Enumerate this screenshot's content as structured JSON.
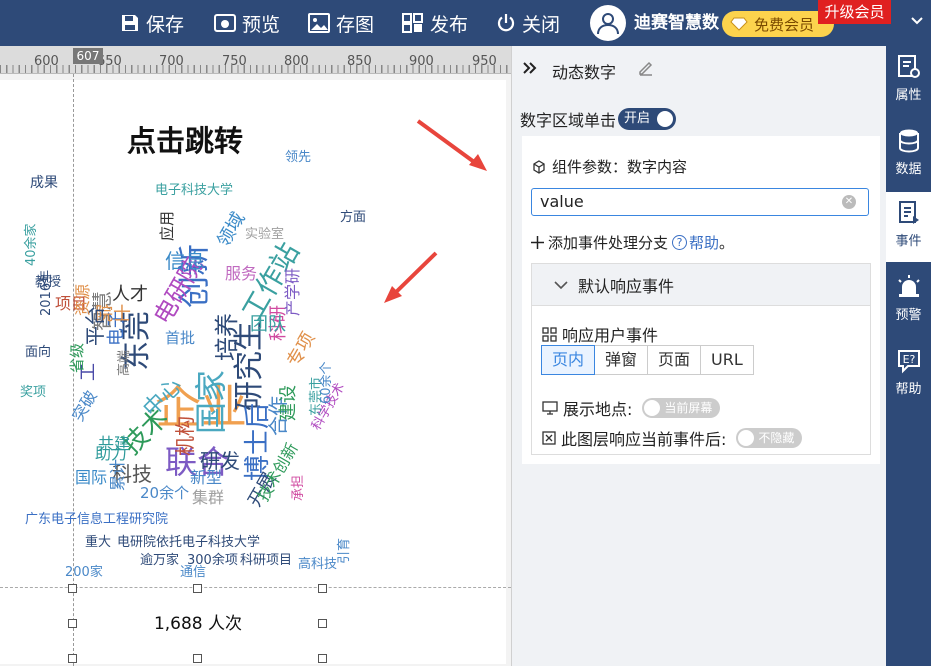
{
  "toolbar": {
    "save": "保存",
    "preview": "预览",
    "save_image": "存图",
    "publish": "发布",
    "close": "关闭",
    "username": "迪赛智慧数",
    "member_badge": "免费会员",
    "upgrade": "升级会员"
  },
  "ruler": {
    "labels": [
      "600",
      "650",
      "700",
      "750",
      "800",
      "850",
      "900",
      "950"
    ],
    "marker": "607"
  },
  "canvas": {
    "title": "点击跳转",
    "counter": "1,688 人次",
    "word_cloud": [
      {
        "t": "企业",
        "c": "#f0a050"
      },
      {
        "t": "创新",
        "c": "#3a6fc4"
      },
      {
        "t": "联合",
        "c": "#7d5bc4"
      },
      {
        "t": "东莞",
        "c": "#2e4a78"
      },
      {
        "t": "国家",
        "c": "#4aa8c0"
      },
      {
        "t": "研究生",
        "c": "#2e4a78"
      },
      {
        "t": "工作站",
        "c": "#3aa0a0"
      },
      {
        "t": "博士后",
        "c": "#3a6fc4"
      },
      {
        "t": "技术",
        "c": "#2e9a5a"
      },
      {
        "t": "合作",
        "c": "#4a88c8"
      },
      {
        "t": "科技",
        "c": "#555555"
      },
      {
        "t": "培养",
        "c": "#2e4a78"
      },
      {
        "t": "电研院",
        "c": "#b04ac0"
      },
      {
        "t": "智慧",
        "c": "#7a7a7a"
      },
      {
        "t": "研发",
        "c": "#2e4a78"
      },
      {
        "t": "信息",
        "c": "#3a8ac8"
      },
      {
        "t": "机构",
        "c": "#c0503a"
      },
      {
        "t": "人才",
        "c": "#333333"
      },
      {
        "t": "工",
        "c": "#4a4aa8"
      },
      {
        "t": "科研",
        "c": "#d04aa0"
      },
      {
        "t": "中心",
        "c": "#4aa8c0"
      },
      {
        "t": "电子",
        "c": "#3a6fc4"
      },
      {
        "t": "院士",
        "c": "#e0904a"
      },
      {
        "t": "服务",
        "c": "#c06ac0"
      },
      {
        "t": "高端",
        "c": "#7a7a7a"
      },
      {
        "t": "新型",
        "c": "#4a88c8"
      },
      {
        "t": "集群",
        "c": "#a0a0a0"
      },
      {
        "t": "国际",
        "c": "#3a8ac8"
      },
      {
        "t": "助力",
        "c": "#2e9a9a"
      },
      {
        "t": "开展",
        "c": "#2e4a78"
      },
      {
        "t": "建设",
        "c": "#2e9a5a"
      },
      {
        "t": "领域",
        "c": "#3a8ac8"
      },
      {
        "t": "产学研",
        "c": "#7d5bc4"
      },
      {
        "t": "团队",
        "c": "#3aa0a0"
      },
      {
        "t": "项目",
        "c": "#c0503a"
      },
      {
        "t": "平台",
        "c": "#2e4a78"
      },
      {
        "t": "专项",
        "c": "#e0904a"
      },
      {
        "t": "省级",
        "c": "#2e9a5a"
      },
      {
        "t": "首批",
        "c": "#4a88c8"
      },
      {
        "t": "应用",
        "c": "#333333"
      },
      {
        "t": "20余个",
        "c": "#4a88c8"
      },
      {
        "t": "技术创新",
        "c": "#2e9a5a"
      },
      {
        "t": "科学技术",
        "c": "#b04ac0"
      },
      {
        "t": "成果",
        "c": "#2e4a78"
      },
      {
        "t": "方面",
        "c": "#2e4a78"
      },
      {
        "t": "电子科技大学",
        "c": "#3aa0a0"
      },
      {
        "t": "广东电子信息工程研究院",
        "c": "#3a6fc4"
      },
      {
        "t": "电研院依托电子科技大学",
        "c": "#2e4a78"
      },
      {
        "t": "高科技",
        "c": "#4a88c8"
      },
      {
        "t": "引育",
        "c": "#4a88c8"
      },
      {
        "t": "300余项",
        "c": "#2e4a78"
      },
      {
        "t": "科研项目",
        "c": "#2e4a78"
      },
      {
        "t": "逾万家",
        "c": "#2e4a78"
      },
      {
        "t": "通信",
        "c": "#4a88c8"
      },
      {
        "t": "200家",
        "c": "#4a88c8"
      },
      {
        "t": "2016年",
        "c": "#2e4a78"
      },
      {
        "t": "教授",
        "c": "#2e4a78"
      },
      {
        "t": "40余家",
        "c": "#3aa0a0"
      },
      {
        "t": "实验室",
        "c": "#a0a0a0"
      },
      {
        "t": "领先",
        "c": "#4a88c8"
      },
      {
        "t": "东莞市",
        "c": "#3aa0a0"
      },
      {
        "t": "60余个",
        "c": "#4a88c8"
      },
      {
        "t": "重大",
        "c": "#2e4a78"
      },
      {
        "t": "共建",
        "c": "#2e9a9a"
      },
      {
        "t": "累计",
        "c": "#4a88c8"
      },
      {
        "t": "面向",
        "c": "#2e4a78"
      },
      {
        "t": "奖项",
        "c": "#3aa0a0"
      },
      {
        "t": "资源",
        "c": "#e0904a"
      },
      {
        "t": "突破",
        "c": "#4a88c8"
      },
      {
        "t": "承担",
        "c": "#d04aa0"
      }
    ]
  },
  "panel": {
    "title": "动态数字",
    "click_label": "数字区域单击",
    "click_toggle": "开启",
    "param_label": "组件参数：数字内容",
    "param_value": "value",
    "add_branch": "添加事件处理分支",
    "help": "帮助",
    "help_suffix": "。",
    "section_title": "默认响应事件",
    "response_label": "响应用户事件",
    "segments": [
      "页内",
      "弹窗",
      "页面",
      "URL"
    ],
    "show_location_label": "展示地点:",
    "show_location_value": "当前屏幕",
    "layer_label": "此图层响应当前事件后:",
    "layer_value": "不隐藏"
  },
  "right_sidebar": {
    "items": [
      "属性",
      "数据",
      "事件",
      "预警",
      "帮助"
    ]
  },
  "colors": {
    "primary": "#2e4a78",
    "accent": "#3a86e0",
    "arrow": "#e8453c",
    "upgrade": "#e02020",
    "badge": "#fcd34d"
  }
}
